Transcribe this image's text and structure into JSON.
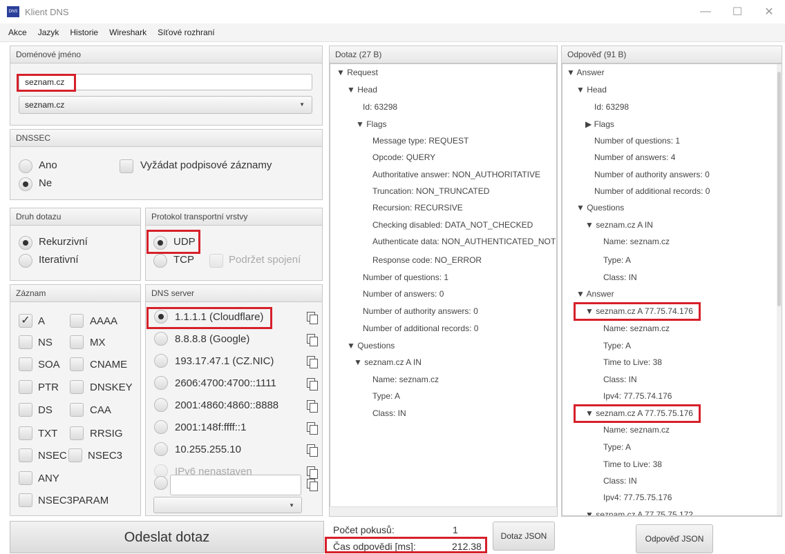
{
  "window": {
    "title": "Klient DNS",
    "app_icon_text": "DNS"
  },
  "menu": [
    "Akce",
    "Jazyk",
    "Historie",
    "Wireshark",
    "Síťové rozhraní"
  ],
  "domain": {
    "header": "Doménové jméno",
    "input_value": "seznam.cz",
    "combo_value": "seznam.cz"
  },
  "dnssec": {
    "header": "DNSSEC",
    "yes": "Ano",
    "no": "Ne",
    "request_sig": "Vyžádat podpisové záznamy"
  },
  "query_type": {
    "header": "Druh dotazu",
    "recursive": "Rekurzivní",
    "iterative": "Iterativní"
  },
  "transport": {
    "header": "Protokol transportní vrstvy",
    "udp": "UDP",
    "tcp": "TCP",
    "keep": "Podržet spojení"
  },
  "record": {
    "header": "Záznam",
    "items": [
      "A",
      "AAAA",
      "NS",
      "MX",
      "SOA",
      "CNAME",
      "PTR",
      "DNSKEY",
      "DS",
      "CAA",
      "TXT",
      "RRSIG",
      "NSEC",
      "NSEC3",
      "ANY",
      "NSEC3PARAM"
    ]
  },
  "dns_server": {
    "header": "DNS server",
    "items": [
      "1.1.1.1 (Cloudflare)",
      "8.8.8.8 (Google)",
      "193.17.47.1 (CZ.NIC)",
      "2606:4700:4700::1111",
      "2001:4860:4860::8888",
      "2001:148f:ffff::1",
      "10.255.255.10",
      "IPv6 nenastaven"
    ]
  },
  "send_button": "Odeslat dotaz",
  "query": {
    "header": "Dotaz (27 B)",
    "tree": [
      "▼ Request",
      "▼ Head",
      "Id: 63298",
      "▼ Flags",
      "Message type: REQUEST",
      "Opcode: QUERY",
      "Authoritative answer: NON_AUTHORITATIVE",
      "Truncation: NON_TRUNCATED",
      "Recursion: RECURSIVE",
      "Checking disabled: DATA_NOT_CHECKED",
      "Authenticate data: NON_AUTHENTICATED_NOT",
      "Response code: NO_ERROR",
      "Number of questions: 1",
      "Number of answers: 0",
      "Number of authority answers: 0",
      "Number of additional records: 0",
      "▼ Questions",
      "▼ seznam.cz A IN",
      "Name: seznam.cz",
      "Type: A",
      "Class: IN"
    ]
  },
  "answer": {
    "header": "Odpověď (91 B)",
    "tree": [
      "▼ Answer",
      "▼ Head",
      "Id: 63298",
      "▶ Flags",
      "Number of questions: 1",
      "Number of answers: 4",
      "Number of authority answers: 0",
      "Number of additional records: 0",
      "▼ Questions",
      "▼ seznam.cz A IN",
      "Name: seznam.cz",
      "Type: A",
      "Class: IN",
      "▼ Answer",
      "▼ seznam.cz A 77.75.74.176",
      "Name: seznam.cz",
      "Type: A",
      "Time to Live: 38",
      "Class: IN",
      "Ipv4: 77.75.74.176",
      "▼ seznam.cz A 77.75.75.176",
      "Name: seznam.cz",
      "Type: A",
      "Time to Live: 38",
      "Class: IN",
      "Ipv4: 77.75.75.176",
      "▼ seznam.cz A 77.75.75.172"
    ]
  },
  "stats": {
    "attempts_label": "Počet pokusů:",
    "attempts_value": "1",
    "time_label": "Čas odpovědi [ms]:",
    "time_value": "212.38"
  },
  "buttons": {
    "query_json": "Dotaz JSON",
    "answer_json": "Odpověď JSON"
  }
}
